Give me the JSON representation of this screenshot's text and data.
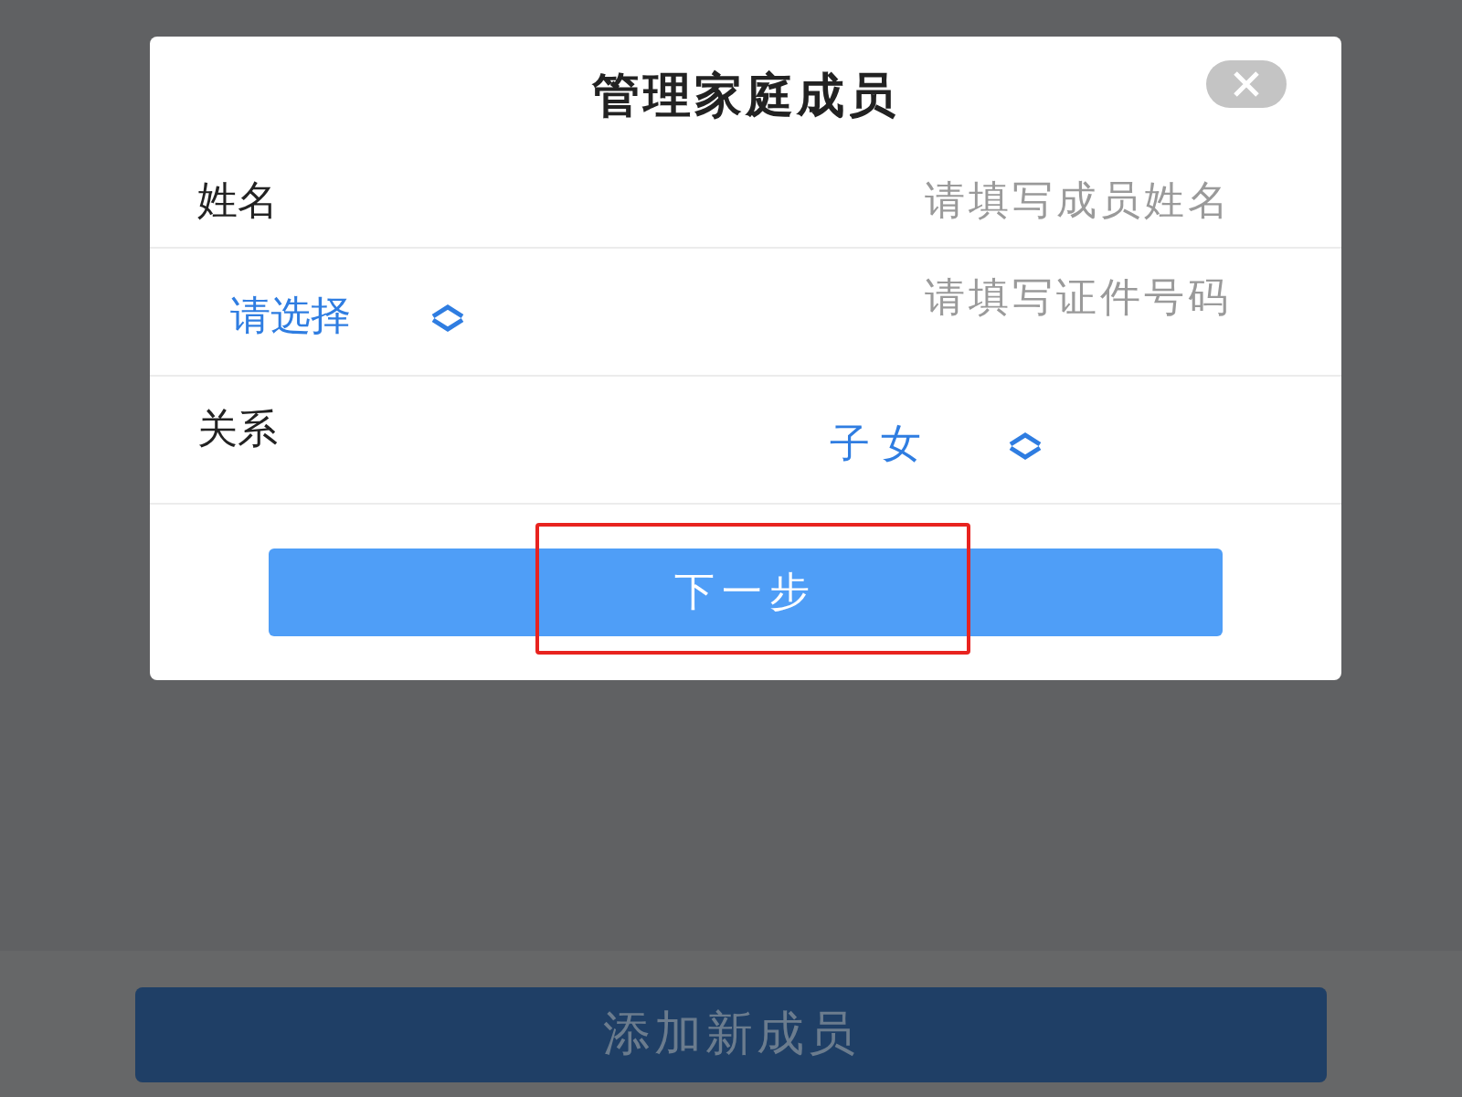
{
  "dialog": {
    "title": "管理家庭成员",
    "fields": [
      {
        "kind": "text",
        "label": "姓名",
        "placeholder": "请填写成员姓名"
      },
      {
        "kind": "id",
        "select": "请选择",
        "placeholder": "请填写证件号码"
      },
      {
        "kind": "select",
        "label": "关系",
        "value": "子女"
      }
    ],
    "button": "下一步",
    "highlighted": true
  },
  "footer_button": "添加新成员"
}
